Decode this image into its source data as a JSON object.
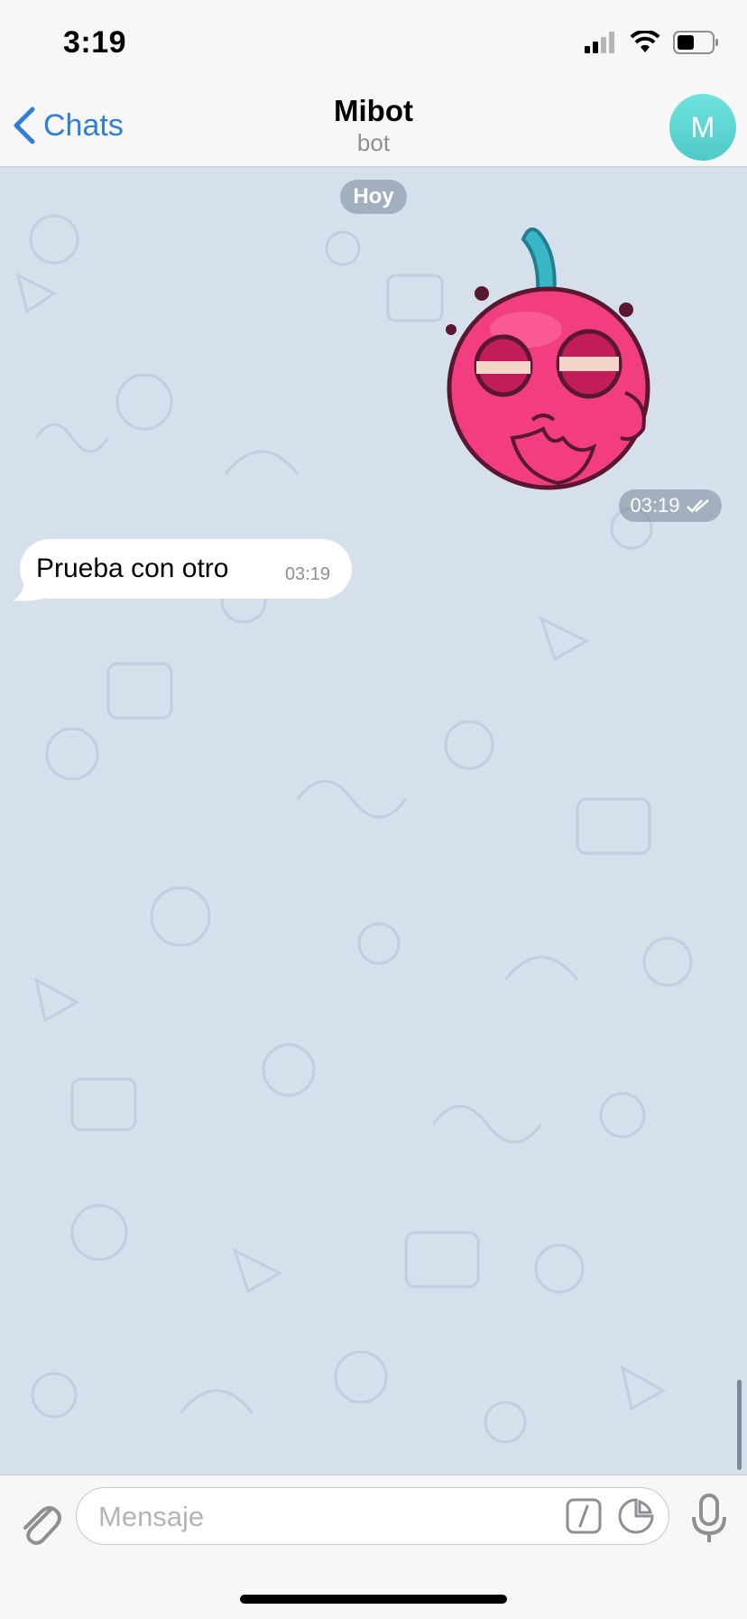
{
  "status_bar": {
    "time": "3:19",
    "icons": [
      "cellular-signal-icon",
      "wifi-icon",
      "battery-icon"
    ]
  },
  "nav": {
    "back_label": "Chats",
    "title": "Mibot",
    "subtitle": "bot",
    "avatar_initial": "M",
    "avatar_color": "#5dd6d3"
  },
  "chat": {
    "date_divider": "Hoy",
    "messages": [
      {
        "type": "sticker",
        "direction": "outgoing",
        "sticker_icon": "cherry-sticker",
        "time": "03:19",
        "status": "read-double-check-icon"
      },
      {
        "type": "text",
        "direction": "incoming",
        "text": "Prueba con otro",
        "time": "03:19"
      }
    ]
  },
  "input": {
    "placeholder": "Mensaje",
    "icons": [
      "paperclip-icon",
      "bot-command-icon",
      "sticker-icon",
      "microphone-icon"
    ]
  },
  "colors": {
    "accent": "#2f7fd8",
    "chat_background": "#d6dfec",
    "bar_background": "#f7f7f7"
  }
}
